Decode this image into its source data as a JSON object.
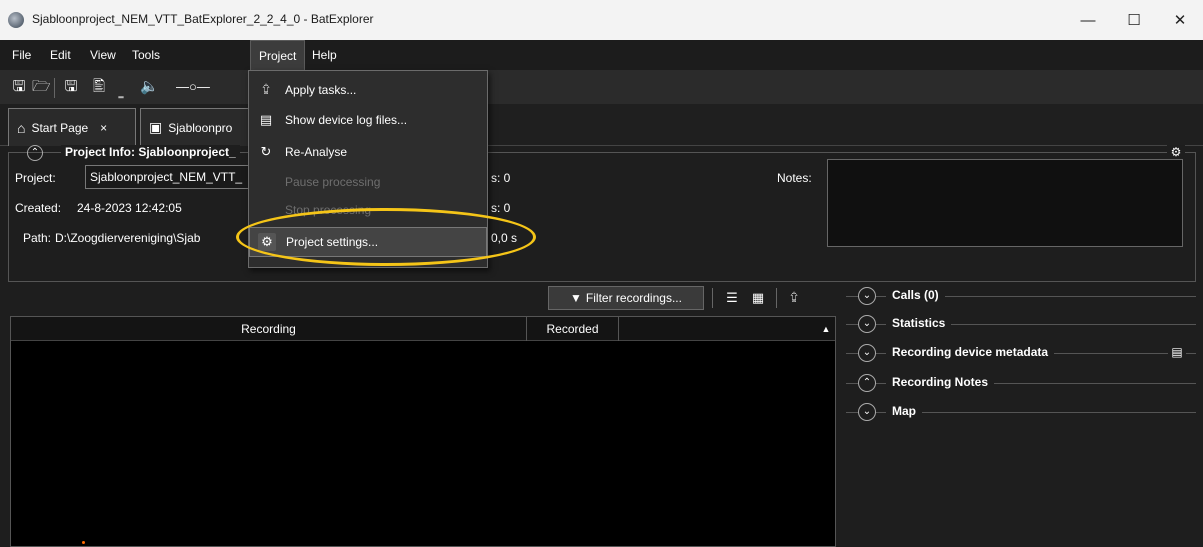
{
  "window": {
    "title": "Sjabloonproject_NEM_VTT_BatExplorer_2_2_4_0 - BatExplorer",
    "minimize": "—",
    "maximize": "☐",
    "close": "✕"
  },
  "menubar": {
    "items": [
      "File",
      "Edit",
      "View",
      "Tools",
      "Project",
      "Help"
    ],
    "active": "Project"
  },
  "tabs": [
    {
      "label": "Start Page",
      "close": "×"
    },
    {
      "label": "Sjabloonpro"
    }
  ],
  "project_info": {
    "title": "Project Info: Sjabloonproject_",
    "project_label": "Project:",
    "project_value": "Sjabloonproject_NEM_VTT_",
    "created_label": "Created:",
    "created_value": "24-8-2023 12:42:05",
    "path_label": "Path:",
    "path_value": "D:\\Zoogdiervereniging\\Sjab",
    "path_suffix": "0,0 s",
    "stat1_value": "s: 0",
    "stat2_value": "s: 0",
    "notes_label": "Notes:"
  },
  "dropdown": {
    "items": [
      {
        "label": "Apply tasks...",
        "icon": "apply-tasks-icon",
        "glyph": "⮸",
        "enabled": true
      },
      {
        "label": "Show device log files...",
        "icon": "log-file-icon",
        "glyph": "▤",
        "enabled": true
      },
      {
        "label": "Re-Analyse",
        "icon": "reanalyse-icon",
        "glyph": "↻",
        "enabled": true
      },
      {
        "label": "Pause processing",
        "icon": "",
        "glyph": "",
        "enabled": false
      },
      {
        "label": "Stop processing",
        "icon": "",
        "glyph": "",
        "enabled": false
      },
      {
        "label": "Project settings...",
        "icon": "settings-icon",
        "glyph": "⚙",
        "enabled": true,
        "highlighted": true
      }
    ]
  },
  "recordings": {
    "filter_label": "Filter recordings...",
    "columns": [
      "Recording",
      "Recorded"
    ]
  },
  "right_panel": {
    "sections": [
      {
        "label": "Calls (0)",
        "state": "expand"
      },
      {
        "label": "Statistics",
        "state": "expand"
      },
      {
        "label": "Recording device metadata",
        "state": "expand"
      },
      {
        "label": "Recording Notes",
        "state": "collapse"
      },
      {
        "label": "Map",
        "state": "expand"
      }
    ]
  },
  "colors": {
    "highlight": "#f5c518",
    "background": "#1e1e1e"
  }
}
